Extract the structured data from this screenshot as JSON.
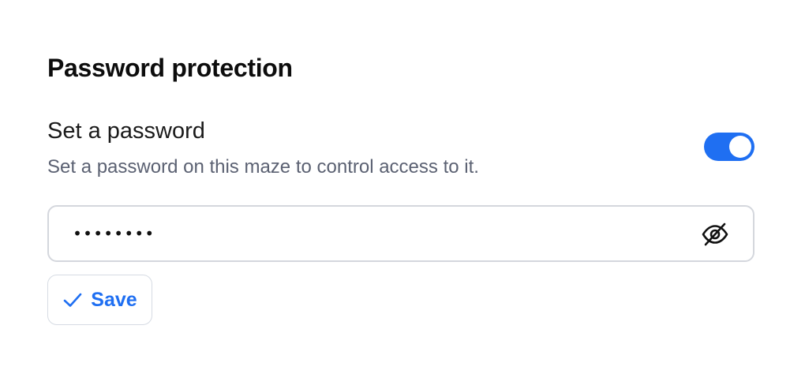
{
  "section": {
    "title": "Password protection"
  },
  "setting": {
    "label": "Set a password",
    "description": "Set a password on this maze to control access to it.",
    "toggle_on": true,
    "accent_color": "#1f6ff2"
  },
  "password_field": {
    "value": "••••••••",
    "icon": "eye-off-icon"
  },
  "save_button": {
    "label": "Save",
    "icon": "check-icon"
  }
}
